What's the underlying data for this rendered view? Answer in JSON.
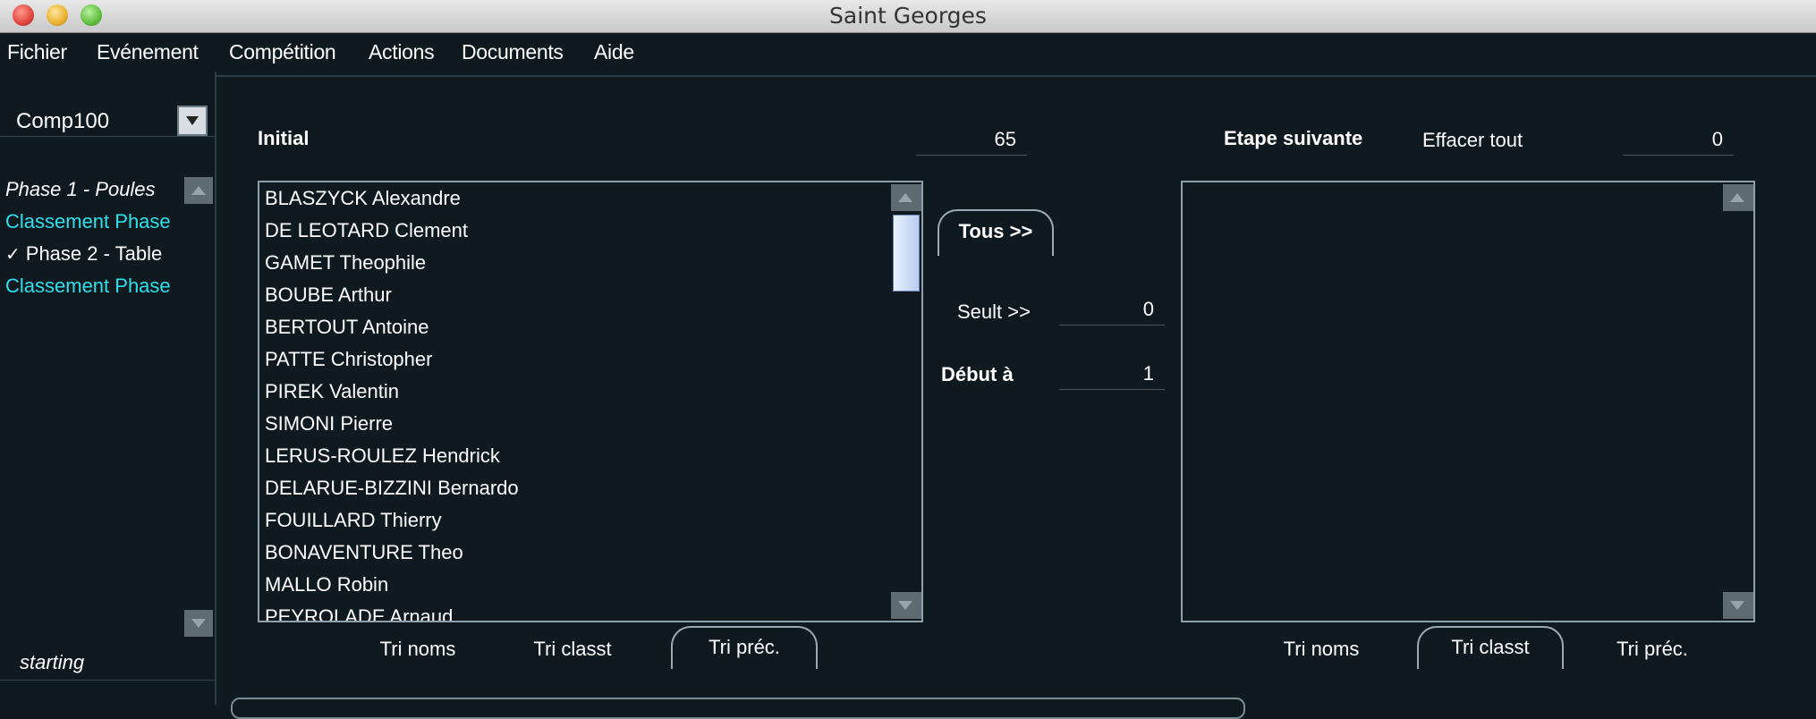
{
  "window": {
    "title": "Saint Georges"
  },
  "menu": [
    "Fichier",
    "Evénement",
    "Compétition",
    "Actions",
    "Documents",
    "Aide"
  ],
  "sidebar": {
    "competition": "Comp100",
    "phases": [
      {
        "label": "Phase 1 - Poules",
        "style": "italic"
      },
      {
        "label": "Classement Phase",
        "style": "cyan"
      },
      {
        "label": "Phase 2 - Table",
        "style": "checked"
      },
      {
        "label": "Classement Phase",
        "style": "cyan"
      }
    ],
    "status": "starting"
  },
  "left_panel": {
    "title": "Initial",
    "count": "65",
    "fencers": [
      "BLASZYCK Alexandre",
      "DE LEOTARD Clement",
      "GAMET Theophile",
      "BOUBE Arthur",
      "BERTOUT Antoine",
      "PATTE Christopher",
      "PIREK Valentin",
      "SIMONI Pierre",
      "LERUS-ROULEZ Hendrick",
      "DELARUE-BIZZINI Bernardo",
      "FOUILLARD Thierry",
      "BONAVENTURE Theo",
      "MALLO Robin",
      "PEYROLADE Arnaud"
    ],
    "sort_buttons": [
      "Tri noms",
      "Tri classt",
      "Tri préc."
    ],
    "selected_sort": "Tri préc."
  },
  "middle": {
    "all_button": "Tous >>",
    "threshold_label": "Seult >>",
    "threshold_value": "0",
    "start_label": "Début à",
    "start_value": "1"
  },
  "right_panel": {
    "title": "Etape suivante",
    "clear_label": "Effacer tout",
    "count": "0",
    "sort_buttons": [
      "Tri noms",
      "Tri classt",
      "Tri préc."
    ],
    "selected_sort": "Tri classt"
  }
}
